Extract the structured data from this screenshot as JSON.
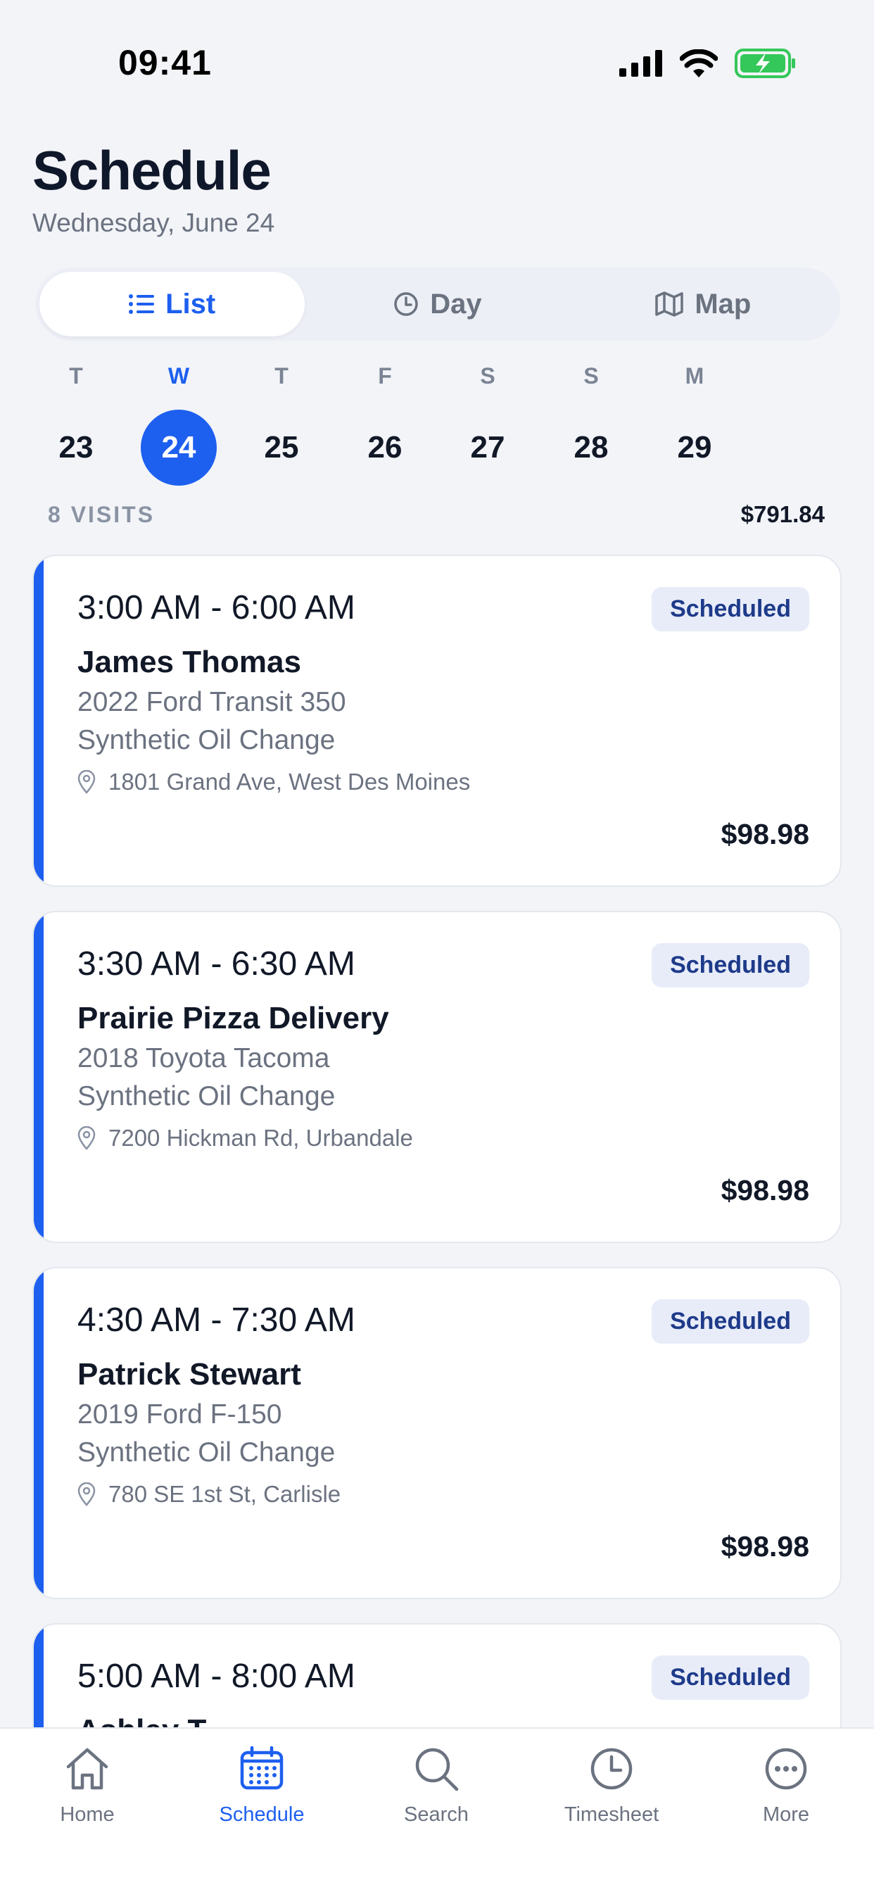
{
  "status_bar": {
    "time": "09:41",
    "icons": [
      "signal-icon",
      "wifi-icon",
      "battery-charging-icon"
    ],
    "battery_color": "#34c759"
  },
  "header": {
    "title": "Schedule",
    "subtitle": "Wednesday, June 24"
  },
  "view_switch": {
    "options": [
      {
        "label": "List",
        "icon": "list-icon",
        "active": true
      },
      {
        "label": "Day",
        "icon": "clock-icon",
        "active": false
      },
      {
        "label": "Map",
        "icon": "map-icon",
        "active": false
      }
    ]
  },
  "week": {
    "days": [
      {
        "letter": "T",
        "number": "23"
      },
      {
        "letter": "W",
        "number": "24",
        "selected": true
      },
      {
        "letter": "T",
        "number": "25"
      },
      {
        "letter": "F",
        "number": "26"
      },
      {
        "letter": "S",
        "number": "27"
      },
      {
        "letter": "S",
        "number": "28"
      },
      {
        "letter": "M",
        "number": "29"
      }
    ]
  },
  "summary": {
    "visits": "8 VISITS",
    "total": "$791.84"
  },
  "visits": [
    {
      "time": "3:00 AM - 6:00 AM",
      "status": "Scheduled",
      "customer": "James Thomas",
      "vehicle": "2022 Ford Transit 350",
      "service": "Synthetic Oil Change",
      "address": "1801 Grand Ave, West Des Moines",
      "price": "$98.98"
    },
    {
      "time": "3:30 AM - 6:30 AM",
      "status": "Scheduled",
      "customer": "Prairie Pizza Delivery",
      "vehicle": "2018 Toyota Tacoma",
      "service": "Synthetic Oil Change",
      "address": "7200 Hickman Rd, Urbandale",
      "price": "$98.98"
    },
    {
      "time": "4:30 AM - 7:30 AM",
      "status": "Scheduled",
      "customer": "Patrick Stewart",
      "vehicle": "2019 Ford F-150",
      "service": "Synthetic Oil Change",
      "address": "780 SE 1st St, Carlisle",
      "price": "$98.98"
    },
    {
      "time": "5:00 AM - 8:00 AM",
      "status": "Scheduled",
      "customer": "Ashley T"
    }
  ],
  "tabbar": {
    "items": [
      {
        "label": "Home",
        "icon": "home-icon",
        "active": false
      },
      {
        "label": "Schedule",
        "icon": "calendar-icon",
        "active": true
      },
      {
        "label": "Search",
        "icon": "search-icon",
        "active": false
      },
      {
        "label": "Timesheet",
        "icon": "clock-icon",
        "active": false
      },
      {
        "label": "More",
        "icon": "more-icon",
        "active": false
      }
    ]
  },
  "colors": {
    "accent": "#1d5fef",
    "badge_bg": "#e7ecf8",
    "badge_text": "#1e3a8a"
  }
}
